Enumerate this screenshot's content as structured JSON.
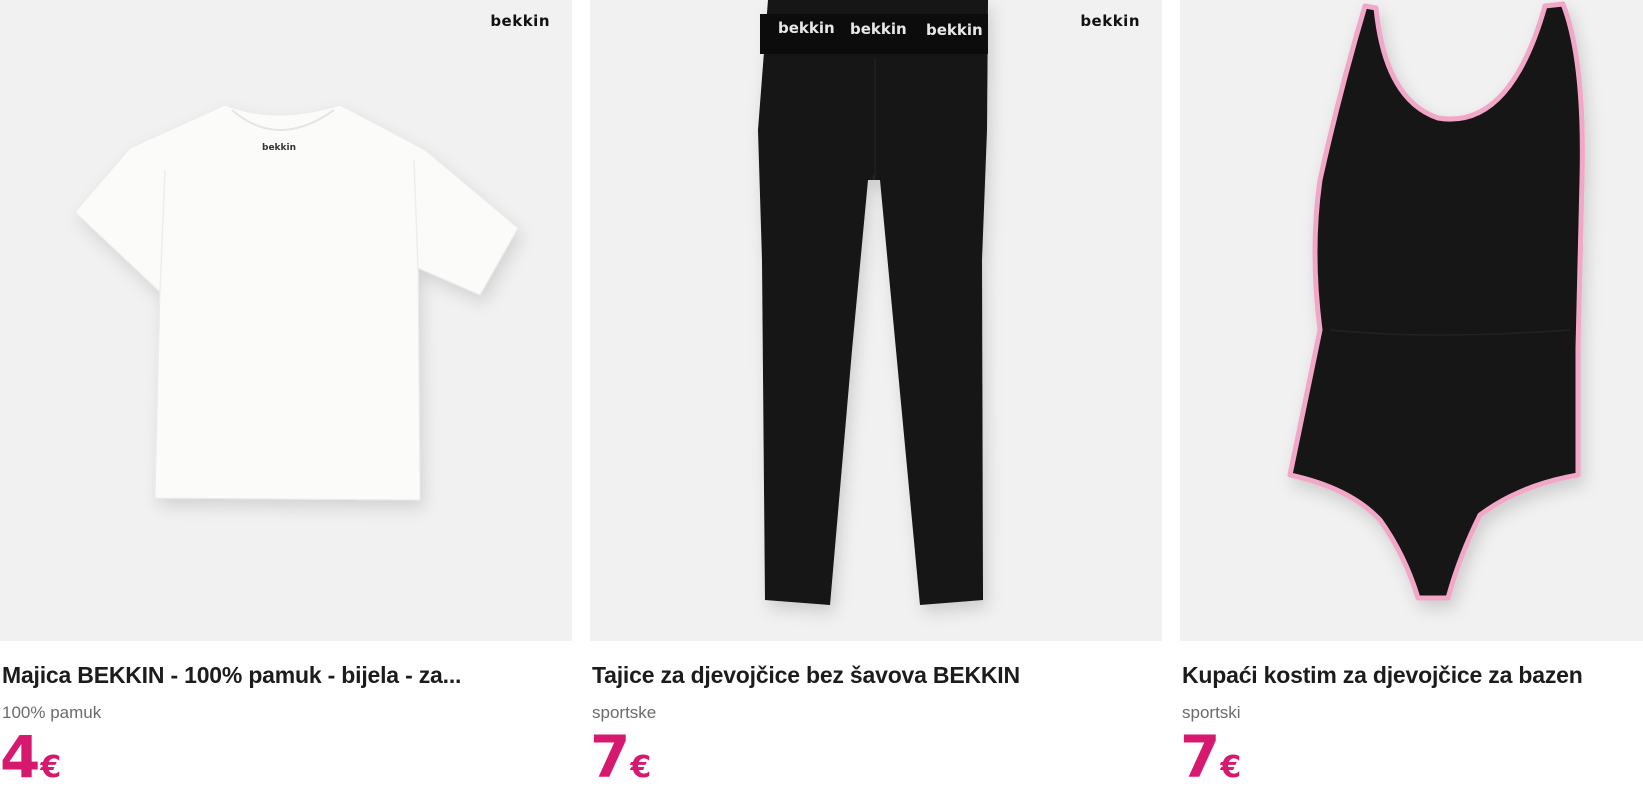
{
  "products": [
    {
      "title": "Majica BEKKIN - 100% pamuk - bijela - za...",
      "subtitle": "100% pamuk",
      "price": "4",
      "currency": "€",
      "brand_logo": "bekkin",
      "neck_label": "bekkin",
      "garment_color": "#ffffff"
    },
    {
      "title": "Tajice za djevojčice bez šavova BEKKIN",
      "subtitle": "sportske",
      "price": "7",
      "currency": "€",
      "brand_logo": "bekkin",
      "waistband_text": "bekkin",
      "garment_color": "#121212"
    },
    {
      "title": "Kupaći kostim za djevojčice za bazen",
      "subtitle": "sportski",
      "price": "7",
      "currency": "€",
      "garment_color": "#141414",
      "trim_color": "#f2a6c8"
    }
  ],
  "colors": {
    "price": "#d6196e",
    "image_background": "#f1f1f1",
    "subtitle": "#6b6b6b"
  }
}
